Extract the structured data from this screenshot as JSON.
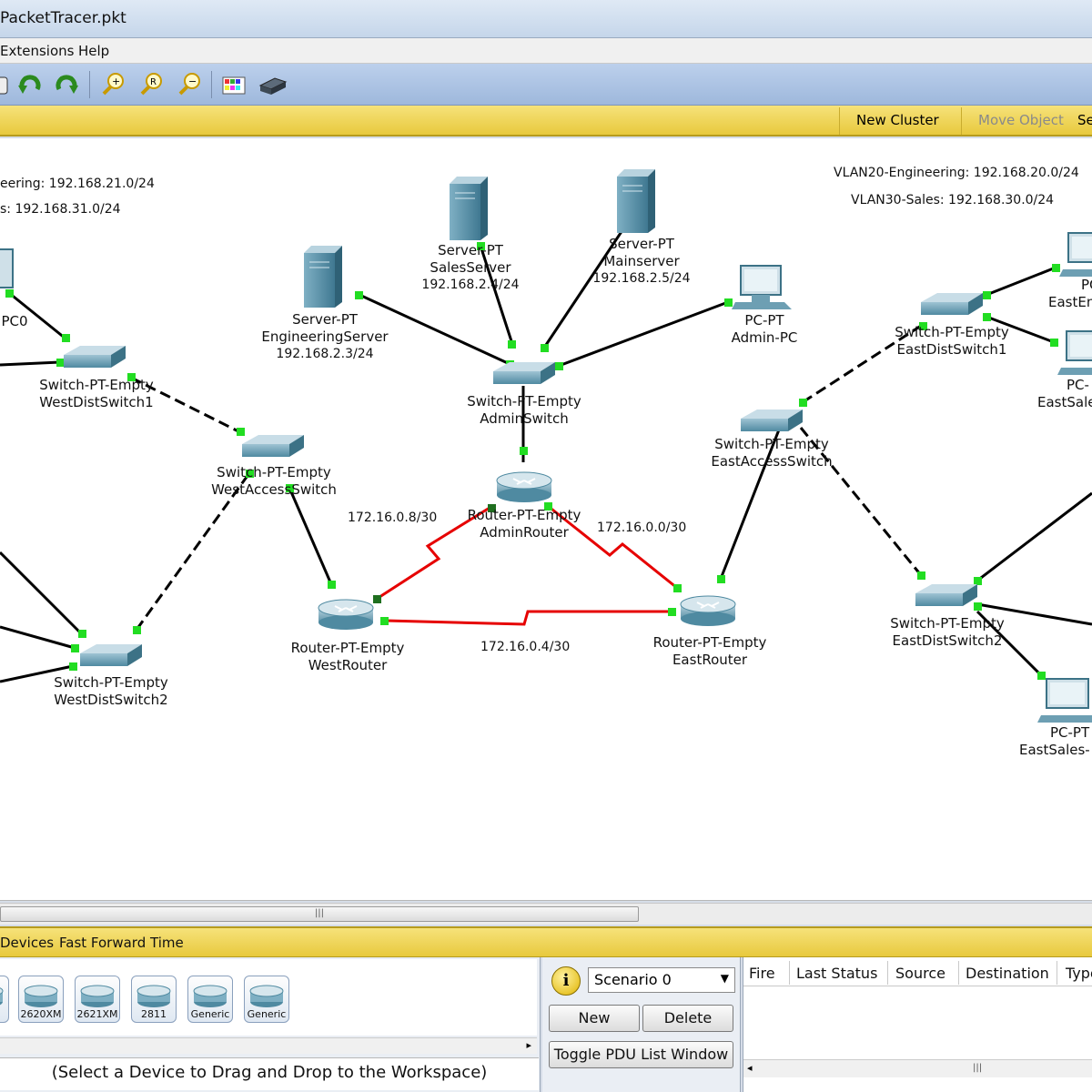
{
  "window": {
    "title": "PacketTracer.pkt"
  },
  "menu": {
    "items": [
      "Extensions",
      "Help"
    ]
  },
  "logical_bar": {
    "new_cluster": "New Cluster",
    "move_object": "Move Object",
    "set_tiled": "Se"
  },
  "workspace": {
    "annotations_left": [
      "eering: 192.168.21.0/24",
      "s: 192.168.31.0/24"
    ],
    "annotations_right": [
      "VLAN20-Engineering: 192.168.20.0/24",
      "VLAN30-Sales: 192.168.30.0/24"
    ],
    "devices": {
      "pc0": {
        "line1": "PC0"
      },
      "west_dist1": {
        "line1": "Switch-PT-Empty",
        "line2": "WestDistSwitch1"
      },
      "west_access": {
        "line1": "Switch-PT-Empty",
        "line2": "WestAccessSwitch"
      },
      "west_dist2": {
        "line1": "Switch-PT-Empty",
        "line2": "WestDistSwitch2"
      },
      "west_router": {
        "line1": "Router-PT-Empty",
        "line2": "WestRouter"
      },
      "eng_server": {
        "line1": "Server-PT",
        "line2": "EngineeringServer",
        "line3": "192.168.2.3/24"
      },
      "sales_server": {
        "line1": "Server-PT",
        "line2": "SalesServer",
        "line3": "192.168.2.4/24"
      },
      "main_server": {
        "line1": "Server-PT",
        "line2": "Mainserver",
        "line3": "192.168.2.5/24"
      },
      "admin_pc": {
        "line1": "PC-PT",
        "line2": "Admin-PC"
      },
      "admin_switch": {
        "line1": "Switch-PT-Empty",
        "line2": "AdminSwitch"
      },
      "admin_router": {
        "line1": "Router-PT-Empty",
        "line2": "AdminRouter"
      },
      "east_router": {
        "line1": "Router-PT-Empty",
        "line2": "EastRouter"
      },
      "east_access": {
        "line1": "Switch-PT-Empty",
        "line2": "EastAccessSwitch"
      },
      "east_dist1": {
        "line1": "Switch-PT-Empty",
        "line2": "EastDistSwitch1"
      },
      "east_dist2": {
        "line1": "Switch-PT-Empty",
        "line2": "EastDistSwitch2"
      },
      "east_eng_pc": {
        "line1": "PC",
        "line2": "EastEn"
      },
      "east_sales_pc": {
        "line1": "PC-",
        "line2": "EastSale"
      },
      "east_sales_pc2": {
        "line1": "PC-PT",
        "line2": "EastSales-"
      }
    },
    "networks": {
      "n1": "172.16.0.8/30",
      "n2": "172.16.0.0/30",
      "n3": "172.16.0.4/30"
    }
  },
  "bottom_bar": {
    "devices": "Devices",
    "fast_forward": "Fast Forward Time"
  },
  "device_list": {
    "items": [
      "",
      "2620XM",
      "2621XM",
      "2811",
      "Generic",
      "Generic"
    ],
    "hint": "(Select a Device to Drag and Drop to the Workspace)"
  },
  "scenario": {
    "selected": "Scenario 0",
    "new_label": "New",
    "delete_label": "Delete",
    "toggle_label": "Toggle PDU List Window"
  },
  "pdu_table": {
    "columns": [
      "Fire",
      "Last Status",
      "Source",
      "Destination",
      "Type"
    ]
  },
  "colors": {
    "serial_link": "#e60000",
    "link_port": "#22dd22",
    "logical_bar": "#f0d55a",
    "toolbar": "#aac2e4"
  }
}
